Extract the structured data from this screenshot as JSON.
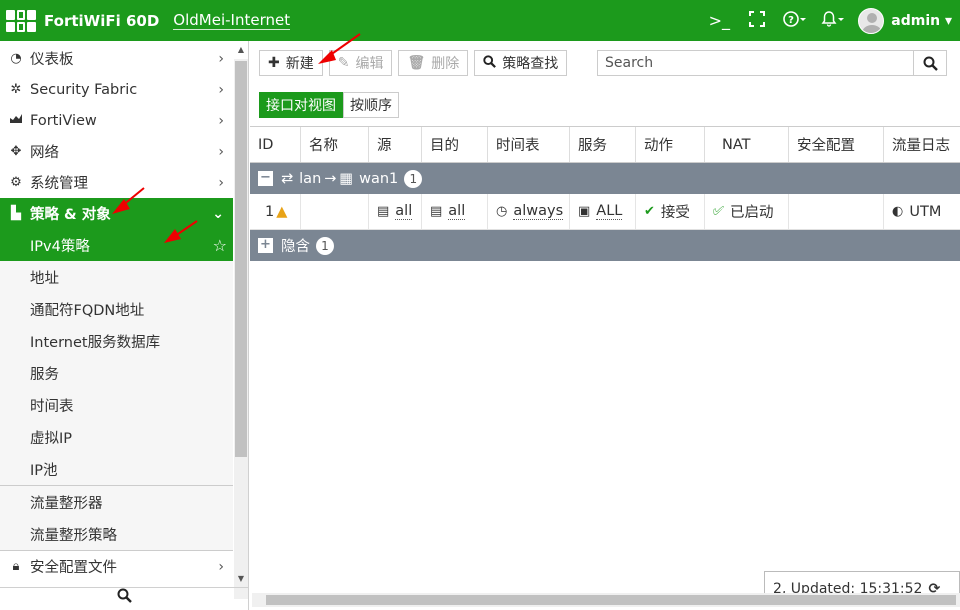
{
  "header": {
    "product_name": "FortiWiFi 60D",
    "hostname": "OldMei-Internet",
    "cli_icon": ">_",
    "fullscreen_icon": "⛶",
    "help_icon": "?",
    "bell_icon": "🔔",
    "user": "admin"
  },
  "sidebar": {
    "items": [
      {
        "label": "仪表板",
        "icon": "dashboard-icon"
      },
      {
        "label": "Security Fabric",
        "icon": "fabric-icon"
      },
      {
        "label": "FortiView",
        "icon": "chart-icon"
      },
      {
        "label": "网络",
        "icon": "network-icon"
      },
      {
        "label": "系统管理",
        "icon": "gear-icon"
      },
      {
        "label": "策略 & 对象",
        "icon": "policy-icon"
      }
    ],
    "subitems": [
      "IPv4策略",
      "地址",
      "通配符FQDN地址",
      "Internet服务数据库",
      "服务",
      "时间表",
      "虚拟IP",
      "IP池",
      "流量整形器",
      "流量整形策略"
    ],
    "bottom_item": "安全配置文件"
  },
  "toolbar": {
    "new_label": "新建",
    "edit_label": "编辑",
    "delete_label": "删除",
    "lookup_label": "策略查找",
    "search_placeholder": "Search"
  },
  "view": {
    "interface_pair": "接口对视图",
    "by_sequence": "按顺序"
  },
  "table": {
    "columns": [
      "ID",
      "名称",
      "源",
      "目的",
      "时间表",
      "服务",
      "动作",
      "NAT",
      "安全配置",
      "流量日志"
    ],
    "group1": {
      "from": "lan",
      "to": "wan1",
      "count": "1"
    },
    "row": {
      "id": "1",
      "name": "",
      "source": "all",
      "destination": "all",
      "schedule": "always",
      "service": "ALL",
      "action": "接受",
      "nat": "已启动",
      "security": "",
      "log": "UTM"
    },
    "group2": {
      "label": "隐含",
      "count": "1"
    }
  },
  "status": {
    "updated_text": "2, Updated: 15:31:52"
  },
  "colors": {
    "brand_green": "#1c9a1c",
    "group_gray": "#7b8693"
  }
}
